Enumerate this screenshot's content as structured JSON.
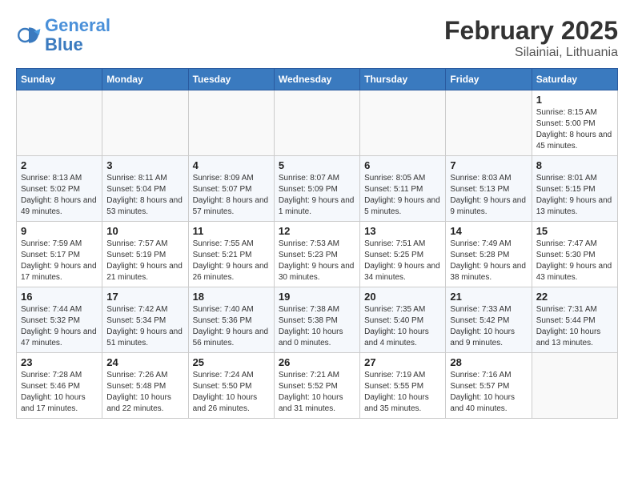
{
  "header": {
    "logo_general": "General",
    "logo_blue": "Blue",
    "title": "February 2025",
    "subtitle": "Silainiai, Lithuania"
  },
  "weekdays": [
    "Sunday",
    "Monday",
    "Tuesday",
    "Wednesday",
    "Thursday",
    "Friday",
    "Saturday"
  ],
  "weeks": [
    [
      {
        "day": "",
        "info": ""
      },
      {
        "day": "",
        "info": ""
      },
      {
        "day": "",
        "info": ""
      },
      {
        "day": "",
        "info": ""
      },
      {
        "day": "",
        "info": ""
      },
      {
        "day": "",
        "info": ""
      },
      {
        "day": "1",
        "info": "Sunrise: 8:15 AM\nSunset: 5:00 PM\nDaylight: 8 hours and 45 minutes."
      }
    ],
    [
      {
        "day": "2",
        "info": "Sunrise: 8:13 AM\nSunset: 5:02 PM\nDaylight: 8 hours and 49 minutes."
      },
      {
        "day": "3",
        "info": "Sunrise: 8:11 AM\nSunset: 5:04 PM\nDaylight: 8 hours and 53 minutes."
      },
      {
        "day": "4",
        "info": "Sunrise: 8:09 AM\nSunset: 5:07 PM\nDaylight: 8 hours and 57 minutes."
      },
      {
        "day": "5",
        "info": "Sunrise: 8:07 AM\nSunset: 5:09 PM\nDaylight: 9 hours and 1 minute."
      },
      {
        "day": "6",
        "info": "Sunrise: 8:05 AM\nSunset: 5:11 PM\nDaylight: 9 hours and 5 minutes."
      },
      {
        "day": "7",
        "info": "Sunrise: 8:03 AM\nSunset: 5:13 PM\nDaylight: 9 hours and 9 minutes."
      },
      {
        "day": "8",
        "info": "Sunrise: 8:01 AM\nSunset: 5:15 PM\nDaylight: 9 hours and 13 minutes."
      }
    ],
    [
      {
        "day": "9",
        "info": "Sunrise: 7:59 AM\nSunset: 5:17 PM\nDaylight: 9 hours and 17 minutes."
      },
      {
        "day": "10",
        "info": "Sunrise: 7:57 AM\nSunset: 5:19 PM\nDaylight: 9 hours and 21 minutes."
      },
      {
        "day": "11",
        "info": "Sunrise: 7:55 AM\nSunset: 5:21 PM\nDaylight: 9 hours and 26 minutes."
      },
      {
        "day": "12",
        "info": "Sunrise: 7:53 AM\nSunset: 5:23 PM\nDaylight: 9 hours and 30 minutes."
      },
      {
        "day": "13",
        "info": "Sunrise: 7:51 AM\nSunset: 5:25 PM\nDaylight: 9 hours and 34 minutes."
      },
      {
        "day": "14",
        "info": "Sunrise: 7:49 AM\nSunset: 5:28 PM\nDaylight: 9 hours and 38 minutes."
      },
      {
        "day": "15",
        "info": "Sunrise: 7:47 AM\nSunset: 5:30 PM\nDaylight: 9 hours and 43 minutes."
      }
    ],
    [
      {
        "day": "16",
        "info": "Sunrise: 7:44 AM\nSunset: 5:32 PM\nDaylight: 9 hours and 47 minutes."
      },
      {
        "day": "17",
        "info": "Sunrise: 7:42 AM\nSunset: 5:34 PM\nDaylight: 9 hours and 51 minutes."
      },
      {
        "day": "18",
        "info": "Sunrise: 7:40 AM\nSunset: 5:36 PM\nDaylight: 9 hours and 56 minutes."
      },
      {
        "day": "19",
        "info": "Sunrise: 7:38 AM\nSunset: 5:38 PM\nDaylight: 10 hours and 0 minutes."
      },
      {
        "day": "20",
        "info": "Sunrise: 7:35 AM\nSunset: 5:40 PM\nDaylight: 10 hours and 4 minutes."
      },
      {
        "day": "21",
        "info": "Sunrise: 7:33 AM\nSunset: 5:42 PM\nDaylight: 10 hours and 9 minutes."
      },
      {
        "day": "22",
        "info": "Sunrise: 7:31 AM\nSunset: 5:44 PM\nDaylight: 10 hours and 13 minutes."
      }
    ],
    [
      {
        "day": "23",
        "info": "Sunrise: 7:28 AM\nSunset: 5:46 PM\nDaylight: 10 hours and 17 minutes."
      },
      {
        "day": "24",
        "info": "Sunrise: 7:26 AM\nSunset: 5:48 PM\nDaylight: 10 hours and 22 minutes."
      },
      {
        "day": "25",
        "info": "Sunrise: 7:24 AM\nSunset: 5:50 PM\nDaylight: 10 hours and 26 minutes."
      },
      {
        "day": "26",
        "info": "Sunrise: 7:21 AM\nSunset: 5:52 PM\nDaylight: 10 hours and 31 minutes."
      },
      {
        "day": "27",
        "info": "Sunrise: 7:19 AM\nSunset: 5:55 PM\nDaylight: 10 hours and 35 minutes."
      },
      {
        "day": "28",
        "info": "Sunrise: 7:16 AM\nSunset: 5:57 PM\nDaylight: 10 hours and 40 minutes."
      },
      {
        "day": "",
        "info": ""
      }
    ]
  ]
}
